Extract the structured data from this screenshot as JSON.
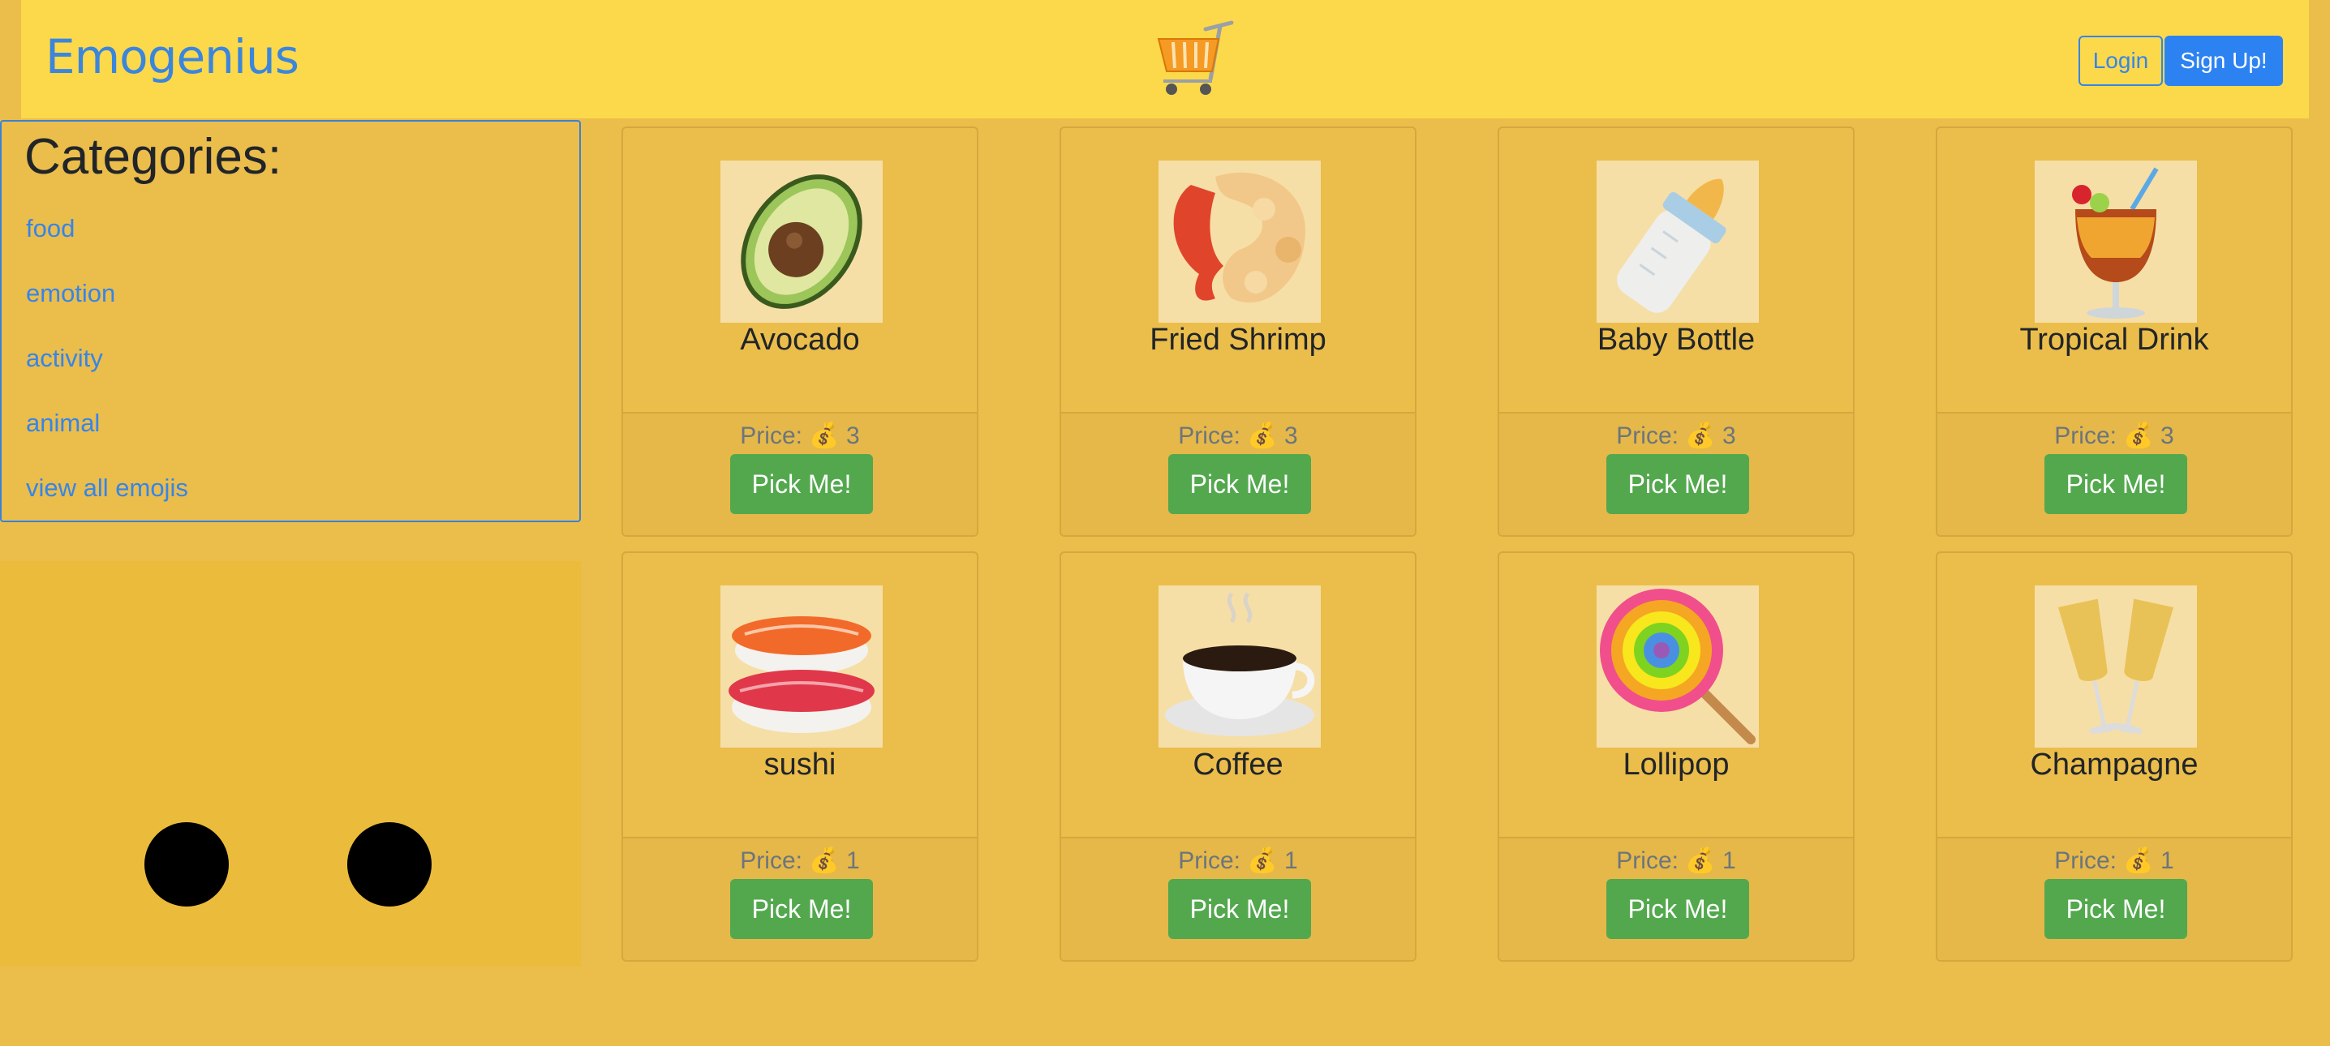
{
  "nav": {
    "brand": "Emogenius",
    "login": "Login",
    "signup": "Sign Up!"
  },
  "categories": {
    "title": "Categories:",
    "items": [
      "food",
      "emotion",
      "activity",
      "animal",
      "view all emojis"
    ]
  },
  "products": [
    {
      "name": "Avocado",
      "price": "Price: 💰 3",
      "button": "Pick Me!",
      "icon": "avocado-icon"
    },
    {
      "name": "Fried Shrimp",
      "price": "Price: 💰 3",
      "button": "Pick Me!",
      "icon": "fried-shrimp-icon"
    },
    {
      "name": "Baby Bottle",
      "price": "Price: 💰 3",
      "button": "Pick Me!",
      "icon": "baby-bottle-icon"
    },
    {
      "name": "Tropical Drink",
      "price": "Price: 💰 3",
      "button": "Pick Me!",
      "icon": "tropical-drink-icon"
    },
    {
      "name": "sushi",
      "price": "Price: 💰 1",
      "button": "Pick Me!",
      "icon": "sushi-icon"
    },
    {
      "name": "Coffee",
      "price": "Price: 💰 1",
      "button": "Pick Me!",
      "icon": "coffee-icon"
    },
    {
      "name": "Lollipop",
      "price": "Price: 💰 1",
      "button": "Pick Me!",
      "icon": "lollipop-icon"
    },
    {
      "name": "Champagne",
      "price": "Price: 💰 1",
      "button": "Pick Me!",
      "icon": "champagne-icon"
    }
  ],
  "colors": {
    "background": "#ebbd4b",
    "navbar": "#fcd94a",
    "link": "#3585ea",
    "button_green": "#53a84e"
  }
}
